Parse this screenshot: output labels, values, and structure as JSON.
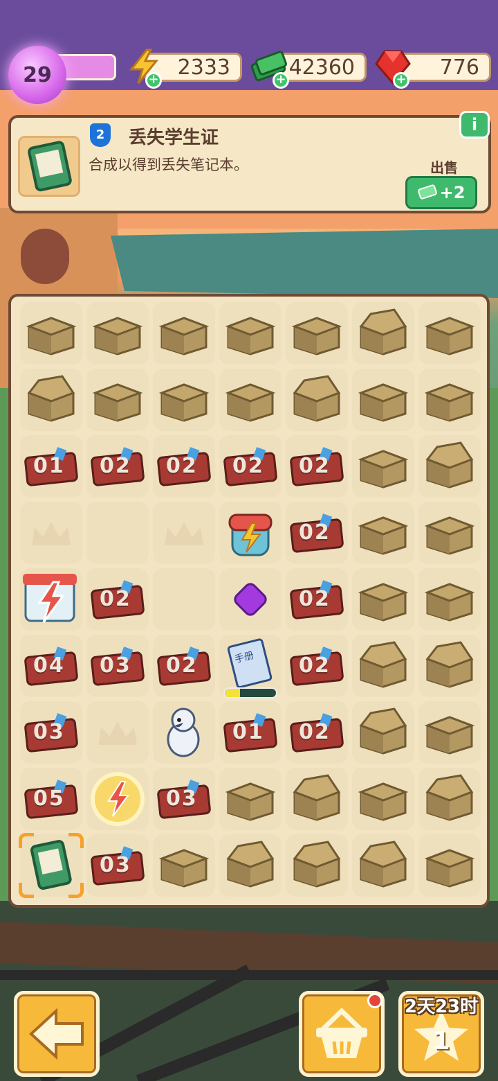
{
  "player": {
    "level": "29"
  },
  "resources": {
    "energy": "2333",
    "cash": "42360",
    "gems": "776"
  },
  "info_panel": {
    "level_badge": "2",
    "title": "丢失学生证",
    "description": "合成以得到丢失笔记本。",
    "sell_label": "出售",
    "sell_value": "+2",
    "info_icon": "i"
  },
  "board": {
    "rows": [
      [
        "box",
        "box",
        "box",
        "box",
        "box",
        "box-open",
        "box"
      ],
      [
        "box-open",
        "box",
        "box",
        "box",
        "box-open",
        "box",
        "box"
      ],
      [
        "ticket-01",
        "ticket-02",
        "ticket-02",
        "ticket-02",
        "ticket-02",
        "box",
        "box-open"
      ],
      [
        "lotus",
        "empty",
        "lotus",
        "energy-backpack",
        "ticket-02",
        "box",
        "box"
      ],
      [
        "energy-store",
        "ticket-02",
        "empty",
        "purple-gem",
        "ticket-02",
        "box",
        "box"
      ],
      [
        "ticket-04",
        "ticket-03",
        "ticket-02",
        "handbook",
        "ticket-02",
        "box-open",
        "box-open"
      ],
      [
        "ticket-03",
        "lotus",
        "parrot",
        "ticket-01",
        "ticket-02",
        "box-open",
        "box"
      ],
      [
        "ticket-05",
        "energy-orb",
        "ticket-03",
        "box",
        "box-open",
        "box",
        "box-open"
      ],
      [
        "student-id",
        "ticket-03",
        "box",
        "box-open",
        "box-open",
        "box-open",
        "box"
      ]
    ],
    "ticket_labels": {
      "ticket-01": "01",
      "ticket-02": "02",
      "ticket-03": "03",
      "ticket-04": "04",
      "ticket-05": "05"
    },
    "handbook_label": "手册",
    "handbook_progress": 0.3
  },
  "bottom": {
    "timer": "2天23时",
    "star_count": "1"
  },
  "colors": {
    "accent": "#f7b93a",
    "panel": "#f6e7c6",
    "border": "#6e4a35",
    "green": "#3fba6c"
  }
}
